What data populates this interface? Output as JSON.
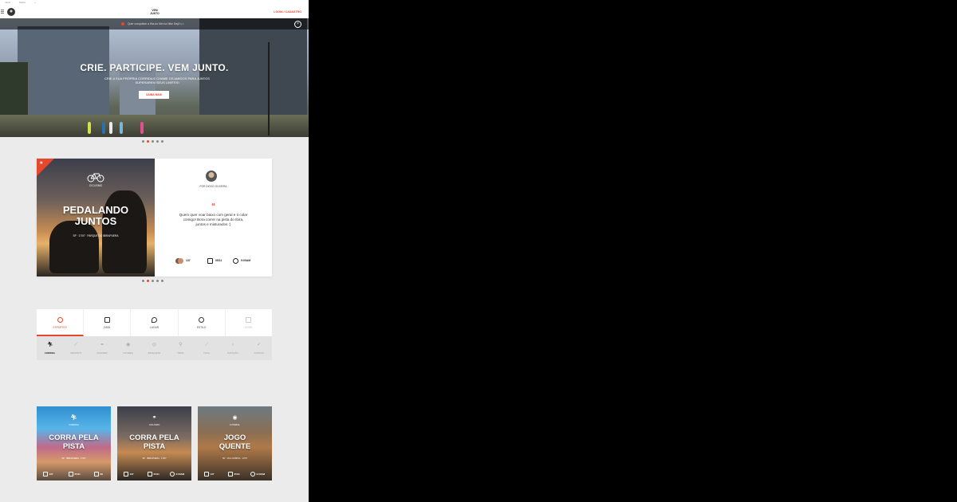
{
  "browser": {
    "tabs": [
      "Início",
      "Sobre",
      "+"
    ]
  },
  "header": {
    "logo_line1": "VEM",
    "logo_line2": "JUNTO",
    "login": "LOGIN / CADASTRO"
  },
  "hero": {
    "notice": "Quer conquistar a Ilha do Mel na Nike Day?",
    "notice_link": "Participe",
    "title": "CRIE. PARTICIPE. VEM JUNTO.",
    "subtitle": "CRIE A SUA PRÓPRIA CORRIDA E CHAME OS AMIGOS PARA JUNTOS SUPERAREM SEUS LIMITES!",
    "button": "SAIBA MAIS",
    "dots": 5,
    "active_dot": 1
  },
  "featured": {
    "category": "CICLISMO",
    "title_line1": "PEDALANDO",
    "title_line2": "JUNTOS",
    "meta": "SP · 17/07 · PARQUE DO IBIRAPUERA",
    "author": "POR DIOGO OLIVEIRA",
    "quote_mark": "“",
    "quote": "Quem quer voar baixo com geral e ó colar comigo! Bora correr na pista do Ibira, juntos e misturados :)",
    "stats": {
      "participants": "137",
      "date": "05/11",
      "time": "9:00AM"
    },
    "dots": 5,
    "active_dot": 1
  },
  "filter": {
    "tabs": [
      {
        "label": "ESPORTES",
        "active": true,
        "disabled": false
      },
      {
        "label": "DATA",
        "active": false,
        "disabled": false
      },
      {
        "label": "LUGAR",
        "active": false,
        "disabled": false
      },
      {
        "label": "ESTILO",
        "active": false,
        "disabled": false
      },
      {
        "label": "LEVEL",
        "active": false,
        "disabled": true
      }
    ],
    "sports": [
      {
        "label": "CORRIDA",
        "icon": "runner-icon",
        "active": true
      },
      {
        "label": "CROSSFIT",
        "icon": "dumbbell-icon",
        "active": false
      },
      {
        "label": "CICLISMO",
        "icon": "bike-icon",
        "active": false
      },
      {
        "label": "FUTEBOL",
        "icon": "soccer-icon",
        "active": false
      },
      {
        "label": "BASQUETE",
        "icon": "basketball-icon",
        "active": false
      },
      {
        "label": "TÊNIS",
        "icon": "tennis-icon",
        "active": false
      },
      {
        "label": "YOGA",
        "icon": "yoga-icon",
        "active": false
      },
      {
        "label": "NATAÇÃO",
        "icon": "swim-icon",
        "active": false
      },
      {
        "label": "OUTROS",
        "icon": "swoosh-icon",
        "active": false
      }
    ]
  },
  "events": [
    {
      "category": "CORRIDA",
      "title_line1": "CORRA PELA",
      "title_line2": "PISTA",
      "meta": "SP · IBIRAPUERA · 17/07",
      "participants": "137",
      "date": "05/11",
      "extra": "08"
    },
    {
      "category": "CICLISMO",
      "title_line1": "CORRA PELA",
      "title_line2": "PISTA",
      "meta": "SP · IBIRAPUERA · 17/07",
      "participants": "137",
      "date": "05/11",
      "extra": "9:00AM"
    },
    {
      "category": "FUTEBOL",
      "title_line1": "JOGO",
      "title_line2": "QUENTE",
      "meta": "SP · VILA OLÍMPIA · 17/07",
      "participants": "137",
      "date": "05/11",
      "extra": "9:00AM"
    }
  ],
  "colors": {
    "accent": "#e5482c",
    "background": "#ebebeb",
    "outside": "#000000"
  }
}
